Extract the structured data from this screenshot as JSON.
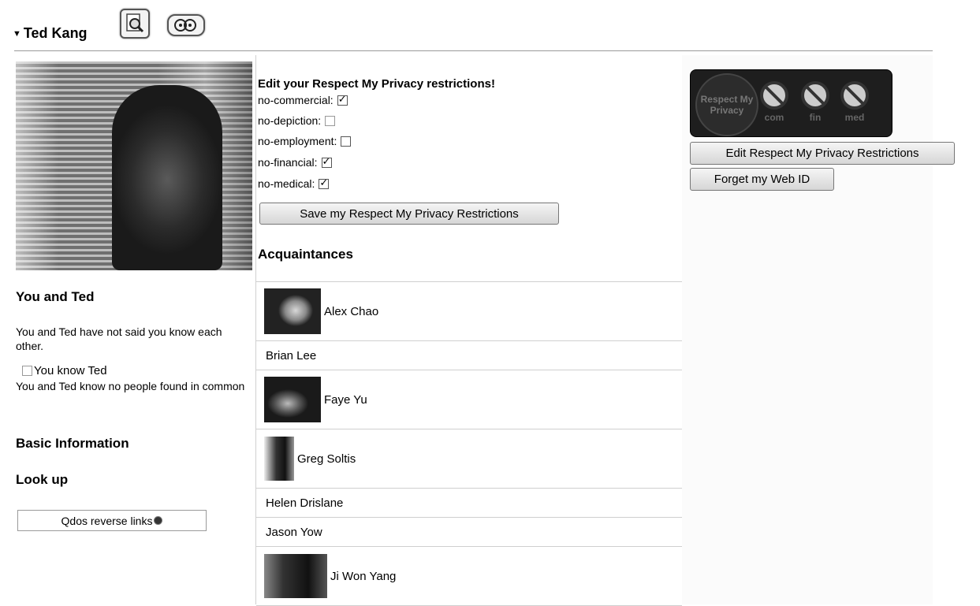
{
  "header": {
    "collapse_glyph": "▼",
    "person_name": "Ted Kang",
    "icons": [
      "magnifier-document-icon",
      "foaf-icon"
    ]
  },
  "left": {
    "you_and_ted_title": "You and Ted",
    "relationship_text": "You and Ted have not said you know each other.",
    "you_know_label": "You know Ted",
    "you_know_checked": false,
    "common_text": "You and Ted know no people found in common",
    "basic_info_title": "Basic Information",
    "lookup_title": "Look up",
    "qdos_label": "Qdos reverse links"
  },
  "privacy": {
    "heading": "Edit your Respect My Privacy restrictions!",
    "restrictions": [
      {
        "label": "no-commercial:",
        "checked": true
      },
      {
        "label": "no-depiction:",
        "checked": false
      },
      {
        "label": "no-employment:",
        "checked": false
      },
      {
        "label": "no-financial:",
        "checked": true
      },
      {
        "label": "no-medical:",
        "checked": true
      }
    ],
    "save_label": "Save my Respect My Privacy Restrictions"
  },
  "acquaintances": {
    "heading": "Acquaintances",
    "items": [
      {
        "name": "Alex Chao",
        "has_photo": true
      },
      {
        "name": "Brian Lee",
        "has_photo": false
      },
      {
        "name": "Faye Yu",
        "has_photo": true
      },
      {
        "name": "Greg Soltis",
        "has_photo": true
      },
      {
        "name": "Helen Drislane",
        "has_photo": false
      },
      {
        "name": "Jason Yow",
        "has_photo": false
      },
      {
        "name": "Ji Won Yang",
        "has_photo": true
      }
    ]
  },
  "right": {
    "badge": {
      "logo_text": "Respect My Privacy",
      "symbols": [
        "com",
        "fin",
        "med"
      ]
    },
    "edit_label": "Edit Respect My Privacy Restrictions",
    "forget_label": "Forget my Web ID"
  },
  "colors": {
    "badge_bg": "#1e1e1e",
    "border": "#cfcfcf"
  }
}
